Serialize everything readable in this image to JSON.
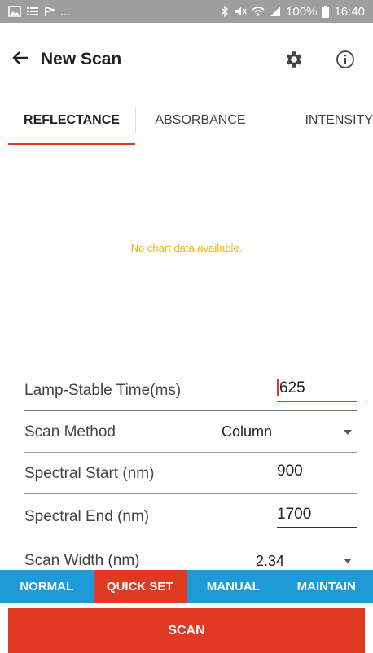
{
  "status_bar": {
    "left_text": "...",
    "battery": "100%",
    "time": "16:40"
  },
  "app_bar": {
    "title": "New Scan"
  },
  "tabs": [
    "REFLECTANCE",
    "ABSORBANCE",
    "INTENSITY"
  ],
  "active_tab": "REFLECTANCE",
  "chart": {
    "empty_message": "No chart data available."
  },
  "form": {
    "lamp_label": "Lamp-Stable Time(ms)",
    "lamp_value": "625",
    "method_label": "Scan Method",
    "method_value": "Column",
    "start_label": "Spectral Start (nm)",
    "start_value": "900",
    "end_label": "Spectral End (nm)",
    "end_value": "1700",
    "width_label": "Scan Width (nm)",
    "width_value": "2.34"
  },
  "modes": [
    "NORMAL",
    "QUICK SET",
    "MANUAL",
    "MAINTAIN"
  ],
  "active_mode": "QUICK SET",
  "scan_label": "SCAN",
  "colors": {
    "accent": "#e03a23",
    "mode_bar": "#1e9ad6",
    "status_bar": "#9e9e9e",
    "empty_text": "#f3b012"
  }
}
